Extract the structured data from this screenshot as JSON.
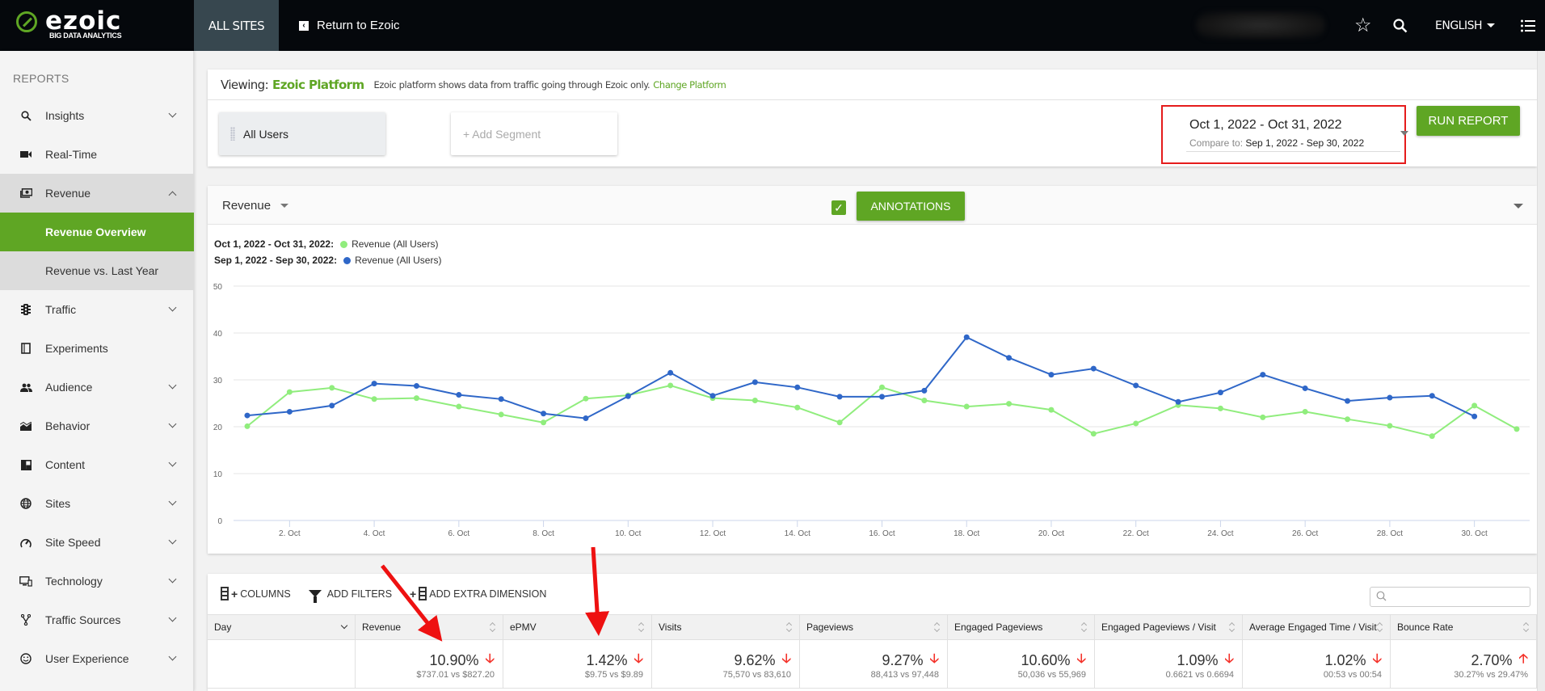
{
  "topbar": {
    "logo_word": "ezoic",
    "logo_sub": "BIG DATA ANALYTICS",
    "all_sites": "ALL SITES",
    "return_label": "Return to Ezoic",
    "language": "ENGLISH"
  },
  "sidebar": {
    "heading": "REPORTS",
    "items": [
      {
        "label": "Insights",
        "icon": "search-icon",
        "chevron": "down"
      },
      {
        "label": "Real-Time",
        "icon": "video-camera-icon",
        "chevron": ""
      },
      {
        "label": "Revenue",
        "icon": "money-icon",
        "chevron": "up"
      },
      {
        "label": "Revenue Overview",
        "sub": true,
        "active": true
      },
      {
        "label": "Revenue vs. Last Year",
        "sub": true
      },
      {
        "label": "Traffic",
        "icon": "traffic-light-icon",
        "chevron": "down"
      },
      {
        "label": "Experiments",
        "icon": "experiment-icon",
        "chevron": ""
      },
      {
        "label": "Audience",
        "icon": "people-icon",
        "chevron": "down"
      },
      {
        "label": "Behavior",
        "icon": "area-chart-icon",
        "chevron": "down"
      },
      {
        "label": "Content",
        "icon": "content-icon",
        "chevron": "down"
      },
      {
        "label": "Sites",
        "icon": "globe-icon",
        "chevron": "down"
      },
      {
        "label": "Site Speed",
        "icon": "speedometer-icon",
        "chevron": "down"
      },
      {
        "label": "Technology",
        "icon": "devices-icon",
        "chevron": "down"
      },
      {
        "label": "Traffic Sources",
        "icon": "fork-icon",
        "chevron": "down"
      },
      {
        "label": "User Experience",
        "icon": "smiley-icon",
        "chevron": "down"
      }
    ]
  },
  "viewing": {
    "label": "Viewing:",
    "platform": "Ezoic Platform",
    "description": "Ezoic platform shows data from traffic going through Ezoic only.",
    "change_link": "Change Platform"
  },
  "segments": {
    "all_users": "All Users",
    "add_segment": "+ Add Segment"
  },
  "date_range": {
    "main": "Oct 1, 2022 - Oct 31, 2022",
    "compare_label": "Compare to:",
    "compare_range": "Sep 1, 2022 - Sep 30, 2022"
  },
  "run_report": "RUN REPORT",
  "chart_header": {
    "metric": "Revenue",
    "annotations_checked": true,
    "annotations_label": "ANNOTATIONS"
  },
  "chart_data": {
    "type": "line",
    "title": "",
    "xlabel": "",
    "ylabel": "",
    "ylim": [
      0,
      50
    ],
    "yticks": [
      0,
      10,
      20,
      30,
      40,
      50
    ],
    "grid": true,
    "legend_position": "top-left",
    "x": [
      1,
      2,
      3,
      4,
      5,
      6,
      7,
      8,
      9,
      10,
      11,
      12,
      13,
      14,
      15,
      16,
      17,
      18,
      19,
      20,
      21,
      22,
      23,
      24,
      25,
      26,
      27,
      28,
      29,
      30,
      31
    ],
    "xtick_labels": [
      "2. Oct",
      "4. Oct",
      "6. Oct",
      "8. Oct",
      "10. Oct",
      "12. Oct",
      "14. Oct",
      "16. Oct",
      "18. Oct",
      "20. Oct",
      "22. Oct",
      "24. Oct",
      "26. Oct",
      "28. Oct",
      "30. Oct"
    ],
    "xtick_values": [
      2,
      4,
      6,
      8,
      10,
      12,
      14,
      16,
      18,
      20,
      22,
      24,
      26,
      28,
      30
    ],
    "series": [
      {
        "range": "Oct 1, 2022 - Oct 31, 2022:",
        "name": "Revenue (All Users)",
        "color": "#90ed7d",
        "values": [
          20.1,
          27.4,
          28.3,
          25.9,
          26.1,
          24.3,
          22.6,
          20.9,
          26.0,
          26.7,
          28.8,
          26.1,
          25.6,
          24.1,
          20.9,
          28.4,
          25.6,
          24.3,
          24.9,
          23.6,
          18.5,
          20.7,
          24.6,
          23.9,
          22.0,
          23.2,
          21.6,
          20.2,
          18.0,
          24.5,
          19.5
        ]
      },
      {
        "range": "Sep 1, 2022 - Sep 30, 2022:",
        "name": "Revenue (All Users)",
        "color": "#2f67c8",
        "values": [
          22.4,
          23.2,
          24.5,
          29.2,
          28.7,
          26.8,
          25.9,
          22.8,
          21.8,
          26.5,
          31.5,
          26.6,
          29.5,
          28.4,
          26.4,
          26.4,
          27.7,
          39.1,
          34.7,
          31.1,
          32.4,
          28.8,
          25.3,
          27.3,
          31.1,
          28.2,
          25.5,
          26.2,
          26.6,
          22.2,
          null
        ]
      }
    ]
  },
  "table_toolbar": {
    "columns": "COLUMNS",
    "add_filters": "ADD FILTERS",
    "add_dimension": "ADD EXTRA DIMENSION",
    "search_placeholder": ""
  },
  "table": {
    "columns": [
      "Day",
      "Revenue",
      "ePMV",
      "Visits",
      "Pageviews",
      "Engaged Pageviews",
      "Engaged Pageviews / Visit",
      "Average Engaged Time / Visit",
      "Bounce Rate"
    ],
    "summary_row": [
      {
        "pct": "",
        "compare": "",
        "direction": ""
      },
      {
        "pct": "10.90%",
        "compare": "$737.01 vs $827.20",
        "direction": "down"
      },
      {
        "pct": "1.42%",
        "compare": "$9.75 vs $9.89",
        "direction": "down"
      },
      {
        "pct": "9.62%",
        "compare": "75,570 vs 83,610",
        "direction": "down"
      },
      {
        "pct": "9.27%",
        "compare": "88,413 vs 97,448",
        "direction": "down"
      },
      {
        "pct": "10.60%",
        "compare": "50,036 vs 55,969",
        "direction": "down"
      },
      {
        "pct": "1.09%",
        "compare": "0.6621 vs 0.6694",
        "direction": "down"
      },
      {
        "pct": "1.02%",
        "compare": "00:53 vs 00:54",
        "direction": "down"
      },
      {
        "pct": "2.70%",
        "compare": "30.27% vs 29.47%",
        "direction": "up"
      }
    ]
  },
  "colors": {
    "brand_green": "#5fa624",
    "topbar": "#05080c",
    "highlight_red": "#e51c1c",
    "trend_red": "#f4322a"
  }
}
